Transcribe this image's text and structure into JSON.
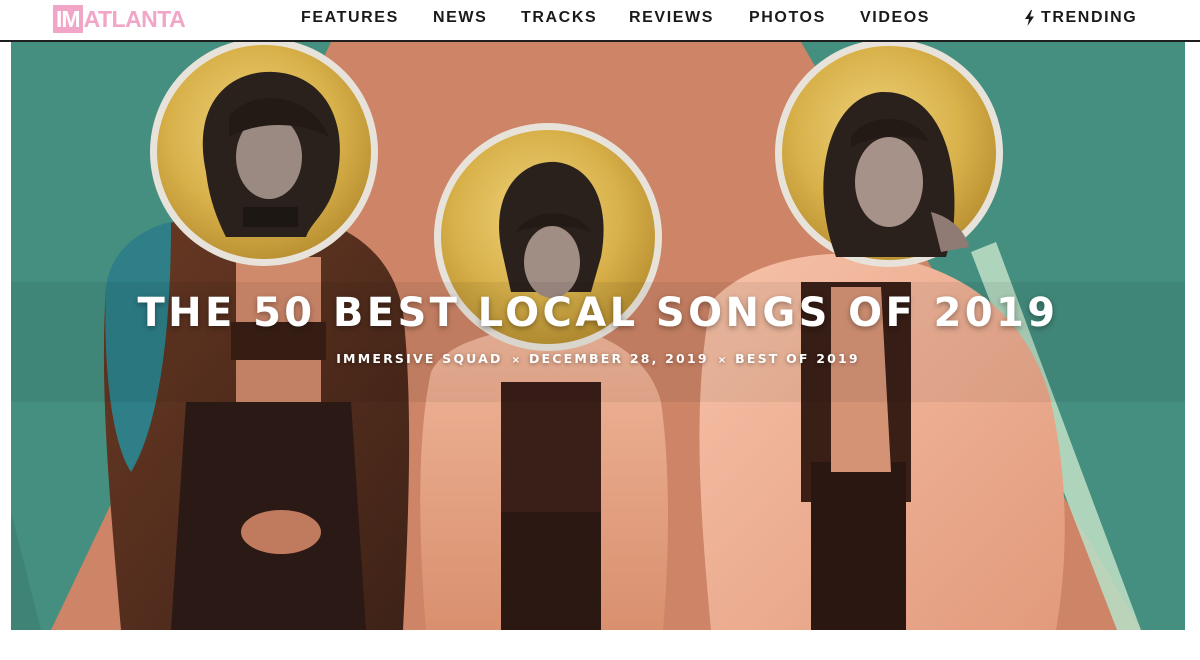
{
  "brand": {
    "logo_box": "IM",
    "logo_word": "ATLANTA",
    "pink": "#f2a6c7"
  },
  "nav": {
    "items": [
      {
        "label": "FEATURES"
      },
      {
        "label": "NEWS"
      },
      {
        "label": "TRACKS"
      },
      {
        "label": "REVIEWS"
      },
      {
        "label": "PHOTOS"
      },
      {
        "label": "VIDEOS"
      }
    ],
    "trending": {
      "label": "TRENDING",
      "icon": "bolt-icon"
    }
  },
  "hero": {
    "title": "THE 50 BEST LOCAL SONGS OF 2019",
    "author": "IMMERSIVE SQUAD",
    "separator": "×",
    "date": "DECEMBER 28, 2019",
    "category": "BEST OF 2019",
    "colors": {
      "teal": "#458f80",
      "salmon": "#cd8467",
      "gold": "#d8b14a"
    }
  }
}
